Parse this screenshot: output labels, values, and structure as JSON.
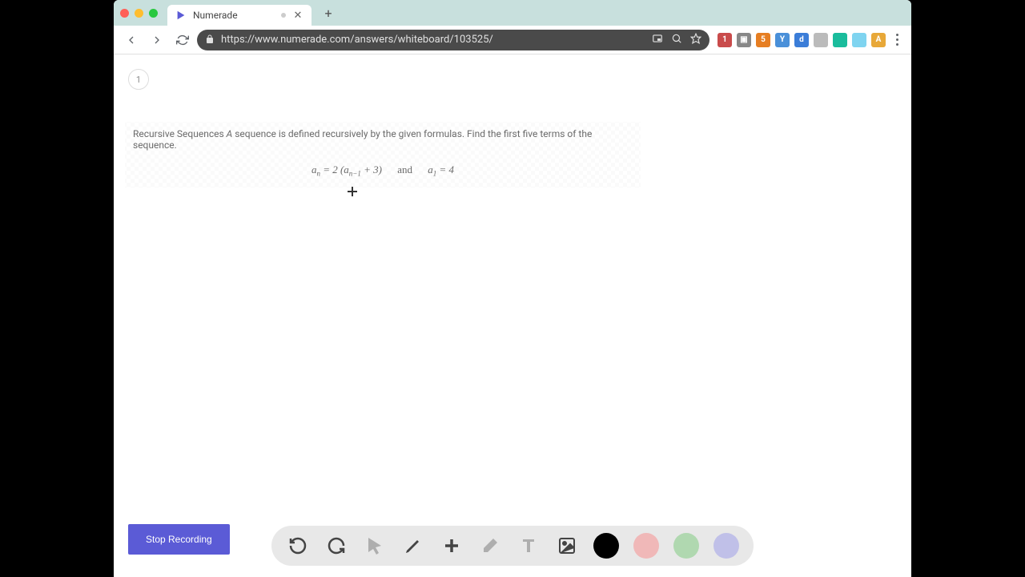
{
  "tab": {
    "title": "Numerade"
  },
  "url": "https://www.numerade.com/answers/whiteboard/103525/",
  "slide_number": "1",
  "problem": {
    "prefix": "Recursive Sequences ",
    "italic": "A",
    "rest": " sequence is defined recursively by the given formulas. Find the first five terms of the sequence."
  },
  "formula": {
    "lhs_var": "a",
    "lhs_sub": "n",
    "eq": " = 2 (",
    "inner_var": "a",
    "inner_sub": "n−1",
    "plus": " + 3)",
    "and": "and",
    "init_var": "a",
    "init_sub": "1",
    "init_val": " = 4"
  },
  "controls": {
    "stop_label": "Stop Recording"
  },
  "extensions": [
    {
      "bg": "#c94b4b",
      "label": "1"
    },
    {
      "bg": "#888",
      "label": "▣"
    },
    {
      "bg": "#e67e22",
      "label": "5"
    },
    {
      "bg": "#4a90d9",
      "label": "Y"
    },
    {
      "bg": "#3b7dd8",
      "label": "d"
    },
    {
      "bg": "#bbb",
      "label": ""
    },
    {
      "bg": "#1abc9c",
      "label": ""
    },
    {
      "bg": "#7fd4f0",
      "label": ""
    },
    {
      "bg": "#e8a838",
      "label": "A"
    }
  ]
}
